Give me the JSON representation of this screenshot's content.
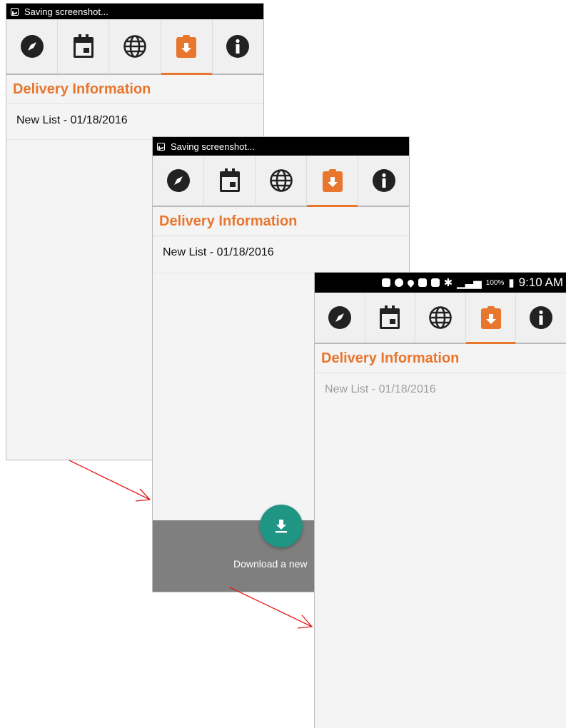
{
  "screens": [
    {
      "status_text": "Saving screenshot...",
      "header": "Delivery Information",
      "list_item": "New List - 01/18/2016"
    },
    {
      "status_text": "Saving screenshot...",
      "header": "Delivery Information",
      "list_item": "New List - 01/18/2016",
      "fab_label": "Download a new"
    },
    {
      "status_battery": "100%",
      "status_time": "9:10 AM",
      "header": "Delivery Information",
      "list_item": "New List - 01/18/2016"
    }
  ],
  "tabs": [
    {
      "icon": "compass-icon"
    },
    {
      "icon": "calendar-icon"
    },
    {
      "icon": "globe-icon"
    },
    {
      "icon": "download-clipboard-icon",
      "active": true
    },
    {
      "icon": "info-icon"
    }
  ],
  "colors": {
    "accent": "#e8762d",
    "fab": "#1f9583",
    "arrow": "#e11b1b"
  }
}
